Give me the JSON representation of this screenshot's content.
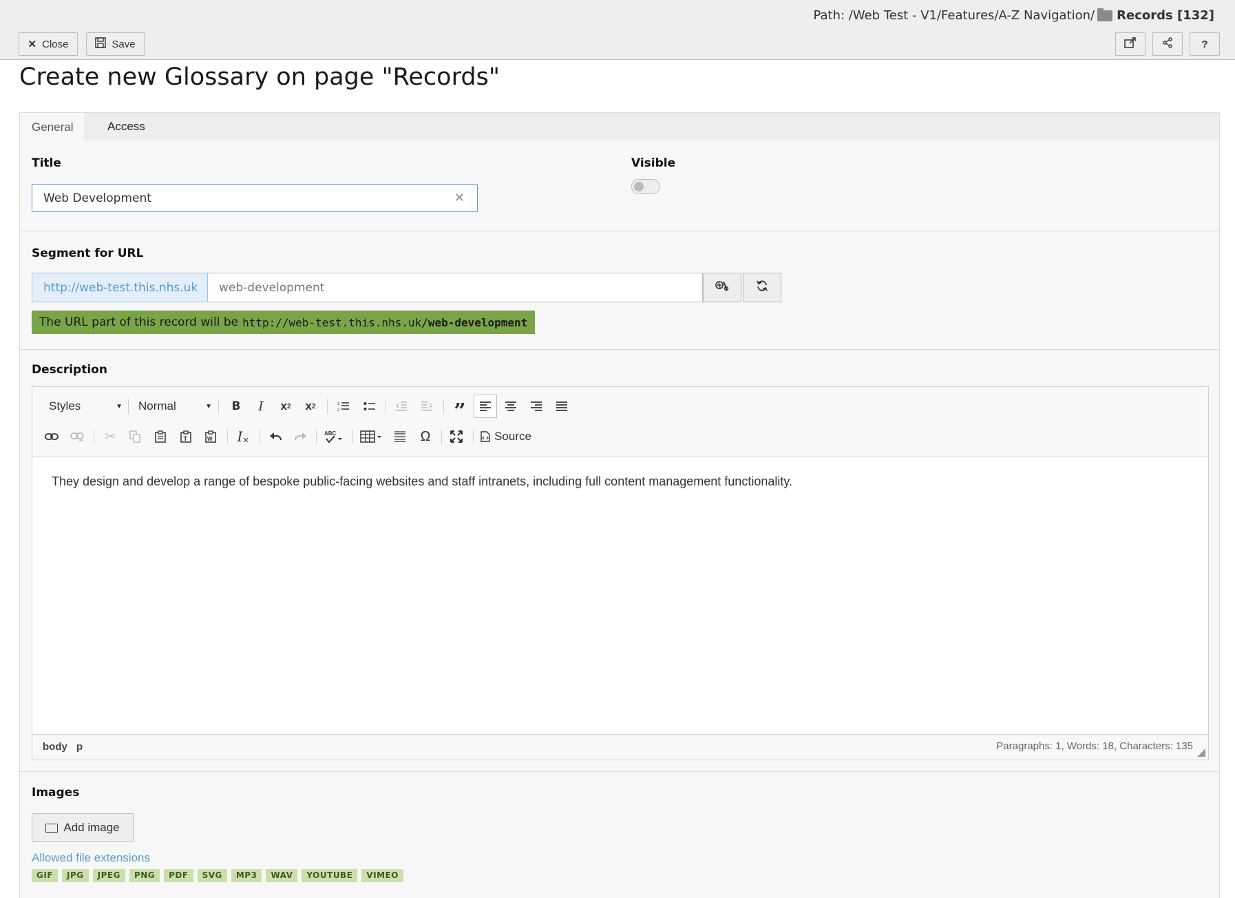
{
  "header": {
    "path_prefix": "Path: /Web Test - V1/Features/A-Z Navigation/",
    "path_current": "Records [132]",
    "close_label": "Close",
    "save_label": "Save",
    "help_label": "?"
  },
  "page_title": "Create new Glossary on page \"Records\"",
  "tabs": [
    {
      "label": "General",
      "active": true
    },
    {
      "label": "Access",
      "active": false
    }
  ],
  "form": {
    "title_label": "Title",
    "title_value": "Web Development",
    "visible_label": "Visible",
    "visible_on": false,
    "segment_label": "Segment for URL",
    "url_prefix": "http://web-test.this.nhs.uk",
    "url_segment": "web-development",
    "url_note_text": "The URL part of this record will be",
    "url_note_base": "http://web-test.this.nhs.uk",
    "url_note_segment": "/web-development",
    "description_label": "Description",
    "editor": {
      "styles_label": "Styles",
      "format_label": "Normal",
      "source_label": "Source",
      "content": "They design and develop a range of bespoke public-facing websites and staff intranets, including full content management functionality.",
      "element_path": [
        "body",
        "p"
      ],
      "stats": "Paragraphs: 1, Words: 18, Characters: 135"
    },
    "images_label": "Images",
    "add_image_label": "Add image",
    "allowed_label": "Allowed file extensions",
    "extensions": [
      "GIF",
      "JPG",
      "JPEG",
      "PNG",
      "PDF",
      "SVG",
      "MP3",
      "WAV",
      "YOUTUBE",
      "VIMEO"
    ]
  },
  "colors": {
    "accent_blue": "#5b9bd5",
    "success_green": "#79a548",
    "extension_badge": "#c9dfae"
  }
}
